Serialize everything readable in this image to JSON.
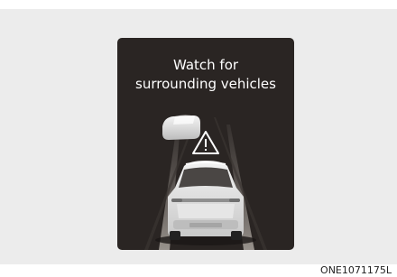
{
  "warning": {
    "line1": "Watch for",
    "line2": "surrounding vehicles"
  },
  "image_code": "ONE1071175L",
  "colors": {
    "background": "#ececec",
    "screen": "#2a2523",
    "text": "#ffffff"
  },
  "icons": {
    "warning": "warning-triangle-icon",
    "vehicle": "rear-view-car-icon",
    "surrounding_vehicle": "side-vehicle-icon"
  }
}
